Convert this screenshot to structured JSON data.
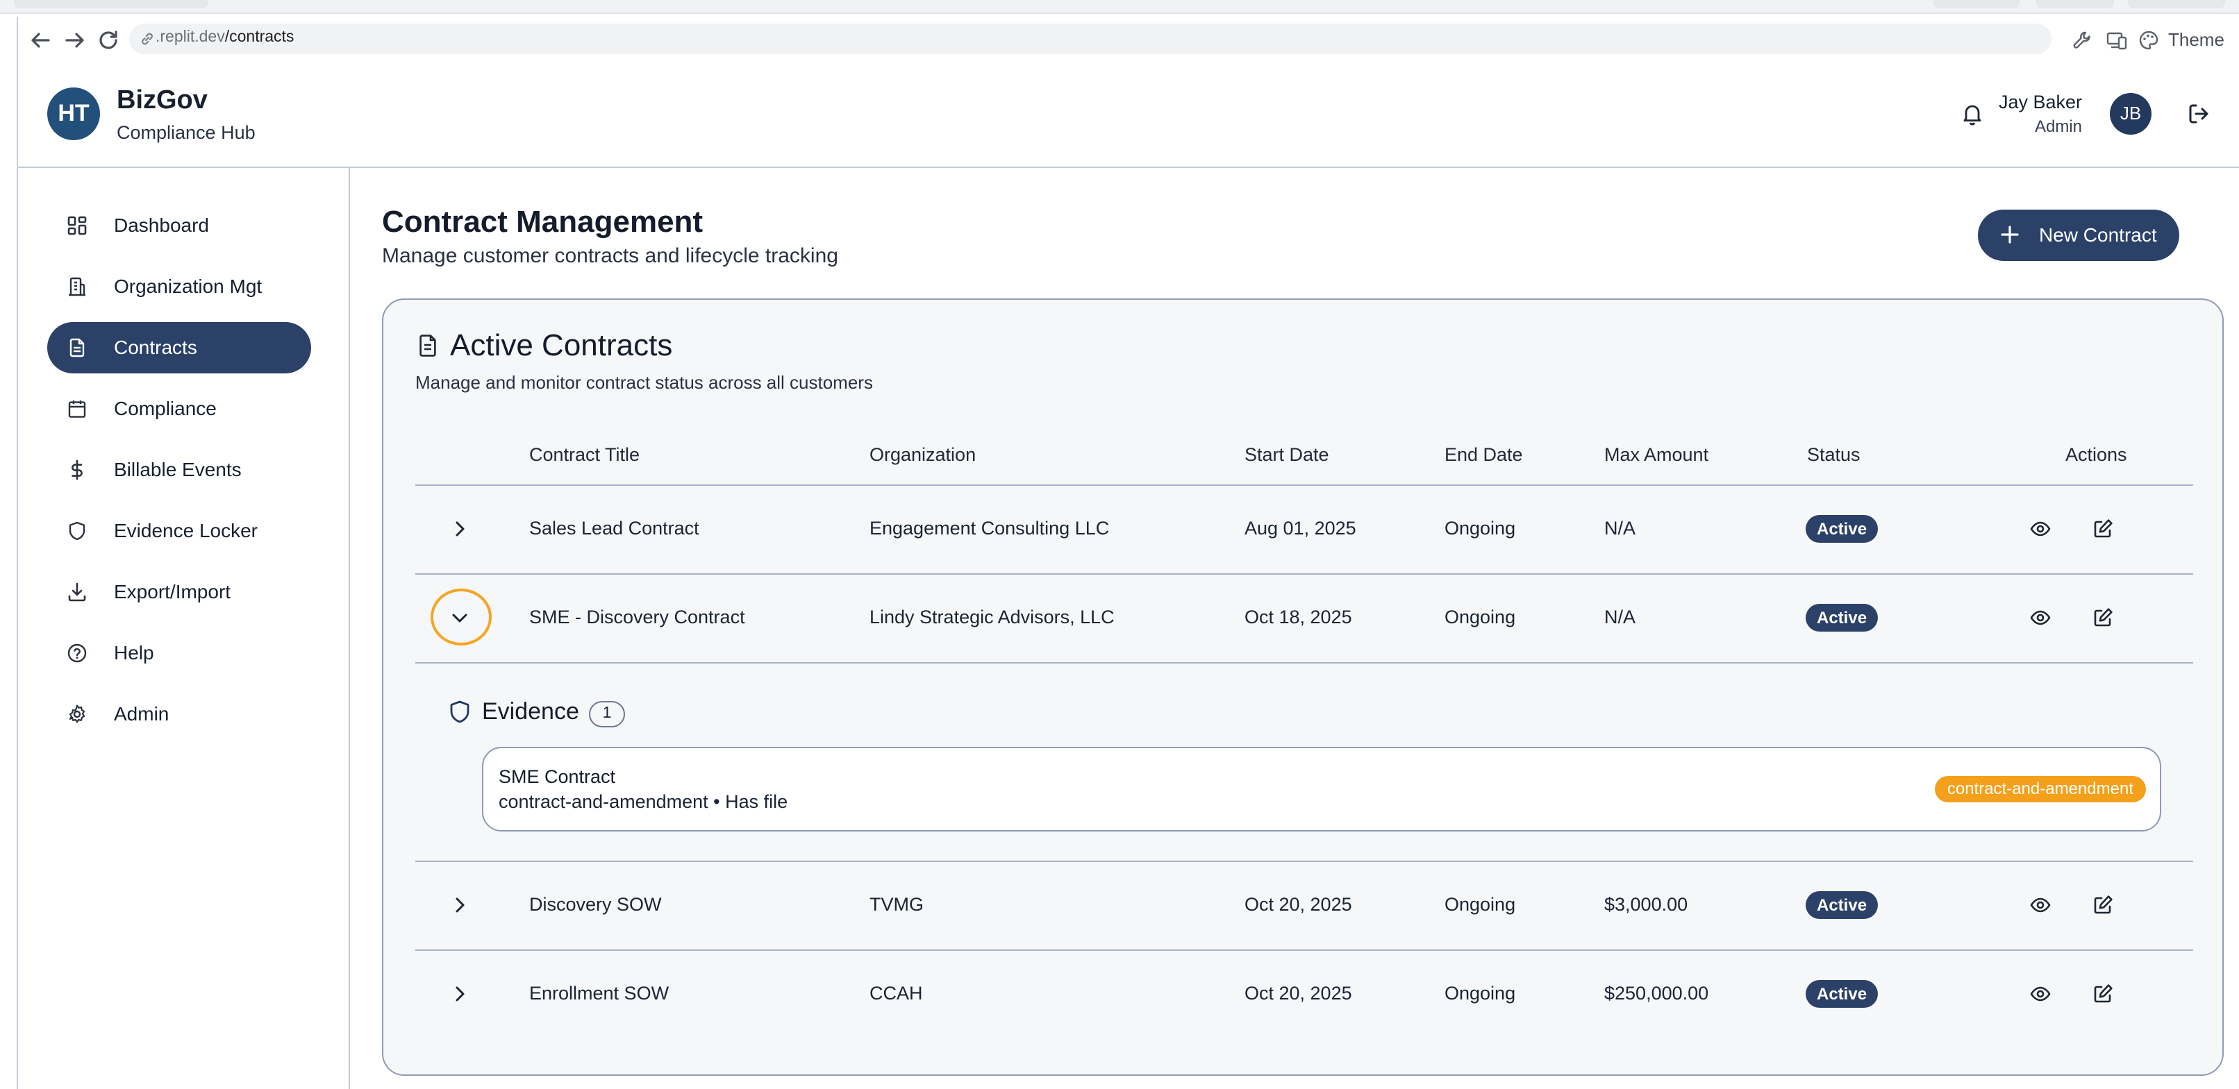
{
  "browser": {
    "url_prefix": ".replit.dev",
    "url_path": "/contracts",
    "theme_label": "Theme"
  },
  "header": {
    "logo_initials": "HT",
    "brand_name": "BizGov",
    "brand_sub": "Compliance Hub",
    "user_name": "Jay Baker",
    "user_role": "Admin",
    "avatar_initials": "JB"
  },
  "sidebar": {
    "items": [
      {
        "label": "Dashboard",
        "icon": "grid-icon"
      },
      {
        "label": "Organization Mgt",
        "icon": "building-icon"
      },
      {
        "label": "Contracts",
        "icon": "document-icon",
        "active": true
      },
      {
        "label": "Compliance",
        "icon": "calendar-icon"
      },
      {
        "label": "Billable Events",
        "icon": "dollar-icon"
      },
      {
        "label": "Evidence Locker",
        "icon": "shield-icon"
      },
      {
        "label": "Export/Import",
        "icon": "download-icon"
      },
      {
        "label": "Help",
        "icon": "help-circle-icon"
      },
      {
        "label": "Admin",
        "icon": "gear-icon"
      }
    ]
  },
  "main": {
    "title": "Contract Management",
    "subtitle": "Manage customer contracts and lifecycle tracking",
    "new_button": "New Contract"
  },
  "card": {
    "title": "Active Contracts",
    "subtitle": "Manage and monitor contract status across all customers",
    "columns": [
      "Contract Title",
      "Organization",
      "Start Date",
      "End Date",
      "Max Amount",
      "Status",
      "Actions"
    ],
    "rows": [
      {
        "title": "Sales Lead Contract",
        "org": "Engagement Consulting LLC",
        "start": "Aug 01, 2025",
        "end": "Ongoing",
        "amount": "N/A",
        "status": "Active"
      },
      {
        "title": "SME - Discovery Contract",
        "org": "Lindy Strategic Advisors, LLC",
        "start": "Oct 18, 2025",
        "end": "Ongoing",
        "amount": "N/A",
        "status": "Active"
      },
      {
        "title": "Discovery SOW",
        "org": "TVMG",
        "start": "Oct 20, 2025",
        "end": "Ongoing",
        "amount": "$3,000.00",
        "status": "Active"
      },
      {
        "title": "Enrollment SOW",
        "org": "CCAH",
        "start": "Oct 20, 2025",
        "end": "Ongoing",
        "amount": "$250,000.00",
        "status": "Active"
      }
    ],
    "evidence": {
      "title": "Evidence",
      "count": "1",
      "item_name": "SME Contract",
      "item_meta": "contract-and-amendment • Has file",
      "item_tag": "contract-and-amendment"
    }
  },
  "colors": {
    "primary": "#2b4168",
    "accent": "#f5a01a",
    "logo_bg": "#23507a"
  }
}
